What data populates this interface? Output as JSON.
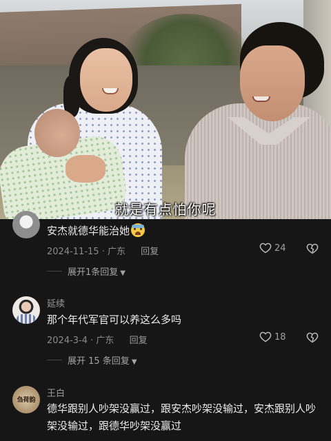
{
  "video": {
    "subtitle": "就是有点怕你呢"
  },
  "comments": [
    {
      "text": "安杰就德华能治她",
      "emoji": "cold-sweat-emoji",
      "date": "2024-11-15",
      "location": "广东",
      "reply_label": "回复",
      "likes": "24",
      "expand_label": "展开1条回复"
    },
    {
      "username": "延续",
      "text": "那个年代军官可以养这么多吗",
      "date": "2024-3-4",
      "location": "广东",
      "reply_label": "回复",
      "likes": "18",
      "expand_label": "展开 15 条回复"
    },
    {
      "username": "王白",
      "avatar_seal": "刍荷韵",
      "text": "德华跟别人吵架没赢过，跟安杰吵架没输过，安杰跟别人吵架没输过，跟德华吵架没赢过"
    }
  ],
  "colors": {
    "background": "#161616",
    "text_primary": "#ececec",
    "text_secondary": "#8a8a8a"
  }
}
